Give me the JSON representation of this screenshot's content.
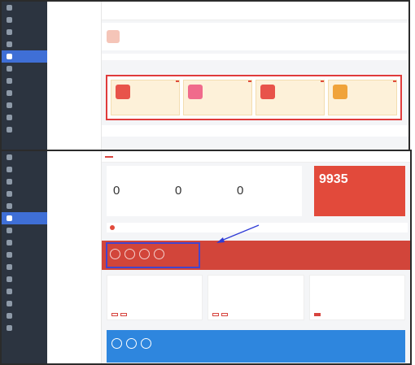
{
  "sidebar_top": [
    {
      "label": "",
      "active": false
    },
    {
      "label": "",
      "active": false
    },
    {
      "label": "",
      "active": false
    },
    {
      "label": "",
      "active": false
    },
    {
      "label": "",
      "active": true
    },
    {
      "label": "",
      "active": false
    },
    {
      "label": "",
      "active": false
    },
    {
      "label": "",
      "active": false
    },
    {
      "label": "",
      "active": false
    },
    {
      "label": "",
      "active": false
    },
    {
      "label": "",
      "active": false
    }
  ],
  "subnav_top": {
    "groups": [
      {
        "title": "",
        "items": [
          "",
          "",
          "",
          ""
        ]
      },
      {
        "title": "",
        "items": [
          "",
          ""
        ]
      },
      {
        "title": "",
        "items": [
          "",
          "",
          "",
          "",
          "",
          "",
          ""
        ]
      }
    ]
  },
  "steps_top": [
    {
      "label": "",
      "date": ""
    },
    {
      "label": "",
      "date": ""
    },
    {
      "label": "",
      "date": ""
    }
  ],
  "info_top": {
    "title": "",
    "desc": "",
    "link": "",
    "right_title": "",
    "right_desc": "",
    "right_link": ""
  },
  "section_title": "",
  "tool_cards": [
    {
      "icon": "",
      "name": "",
      "desc": "",
      "hot": "",
      "color": "#e8534a"
    },
    {
      "icon": "",
      "name": "",
      "desc": "",
      "hot": "",
      "color": "#f06b8c"
    },
    {
      "icon": "",
      "name": "",
      "desc": "",
      "hot": "",
      "color": "#e8534a"
    },
    {
      "icon": "",
      "name": "",
      "desc": "",
      "hot": "",
      "color": "#f0a33a"
    }
  ],
  "tabs_top": [
    "",
    "",
    ""
  ],
  "sidebar_bottom": [
    {
      "label": "",
      "active": false
    },
    {
      "label": "",
      "active": false
    },
    {
      "label": "",
      "active": false
    },
    {
      "label": "",
      "active": false
    },
    {
      "label": "",
      "active": false
    },
    {
      "label": "",
      "active": true
    },
    {
      "label": "",
      "active": false
    },
    {
      "label": "",
      "active": false
    },
    {
      "label": "",
      "active": false
    },
    {
      "label": "",
      "active": false
    },
    {
      "label": "",
      "active": false
    },
    {
      "label": "",
      "active": false
    },
    {
      "label": "",
      "active": false
    },
    {
      "label": "",
      "active": false
    },
    {
      "label": "",
      "active": false
    }
  ],
  "subnav_bottom": {
    "groups": [
      {
        "title": "",
        "items": [
          "",
          "",
          ""
        ]
      },
      {
        "title": "",
        "items": [
          "",
          ""
        ]
      },
      {
        "title": "",
        "items": [
          "",
          "",
          ""
        ]
      },
      {
        "title": "",
        "items": [
          "",
          "",
          ""
        ]
      },
      {
        "title": "",
        "items": [
          "",
          "",
          "",
          "",
          "",
          "",
          ""
        ]
      }
    ]
  },
  "topbar": {
    "tag": "",
    "crumb": ""
  },
  "stats": {
    "title": "",
    "items": [
      {
        "value": "0",
        "label": ""
      },
      {
        "value": "0",
        "label": ""
      },
      {
        "value": "0",
        "label": ""
      }
    ]
  },
  "balance": {
    "label": "",
    "value": "9935",
    "link": ""
  },
  "notice": "",
  "banner_chars": [
    "",
    "",
    "",
    ""
  ],
  "promo_cards": [
    {
      "title": "",
      "sub": "",
      "text": "",
      "btns": [
        "",
        ""
      ],
      "solid": false
    },
    {
      "title": "",
      "sub": "",
      "text": "",
      "btns": [
        "",
        ""
      ],
      "solid": false
    },
    {
      "title": "",
      "sub": "",
      "text": "",
      "btns": [
        ""
      ],
      "solid": true
    }
  ],
  "blue_chars": [
    "",
    "",
    ""
  ],
  "blue_text": ""
}
